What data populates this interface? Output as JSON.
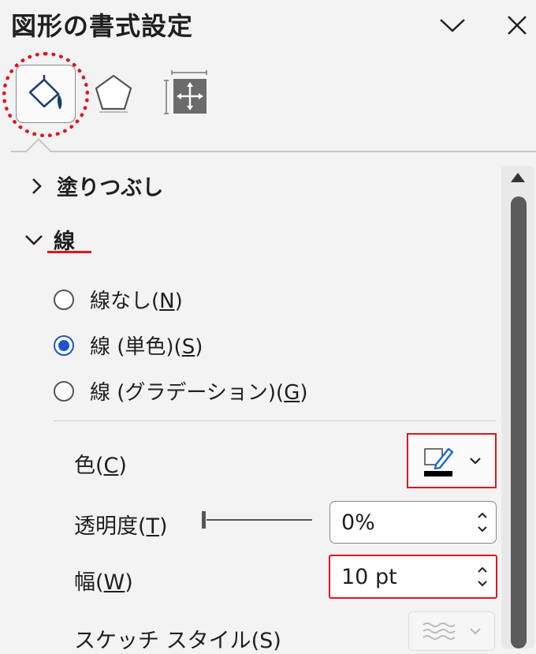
{
  "header": {
    "title": "図形の書式設定",
    "collapse_icon": "chevron-down-icon",
    "close_icon": "close-icon"
  },
  "tabs": [
    {
      "name": "fill-and-line",
      "icon": "paint-bucket-icon",
      "selected": true
    },
    {
      "name": "effects",
      "icon": "pentagon-icon",
      "selected": false
    },
    {
      "name": "size-and-properties",
      "icon": "size-move-icon",
      "selected": false
    }
  ],
  "sections": {
    "fill": {
      "label": "塗りつぶし",
      "expanded": false
    },
    "line": {
      "label": "線",
      "expanded": true
    }
  },
  "line_options": [
    {
      "text": "線なし(",
      "mnemonic": "N",
      "close": ")",
      "checked": false
    },
    {
      "text": "線 (単色)(",
      "mnemonic": "S",
      "close": ")",
      "checked": true
    },
    {
      "text": "線 (グラデーション)(",
      "mnemonic": "G",
      "close": ")",
      "checked": false
    }
  ],
  "properties": {
    "color": {
      "label": "色(",
      "mnemonic": "C",
      "close": ")",
      "swatch": "#000000"
    },
    "transparency": {
      "label": "透明度(",
      "mnemonic": "T",
      "close": ")",
      "value": "0%",
      "level": 0
    },
    "width": {
      "label": "幅(",
      "mnemonic": "W",
      "close": ")",
      "value": "10 pt"
    },
    "sketch": {
      "label": "スケッチ スタイル(S)"
    }
  },
  "colors": {
    "accent_red": "#e0151f",
    "radio_blue": "#1a56c9",
    "pen_blue": "#1f66d1"
  }
}
